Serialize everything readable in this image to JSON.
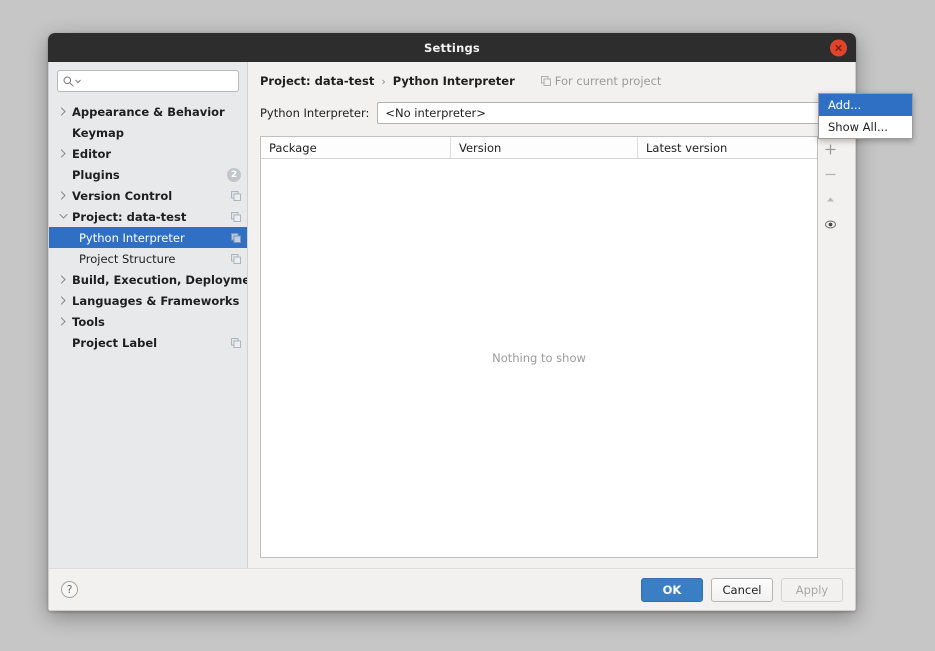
{
  "window": {
    "title": "Settings",
    "close_icon": "close-icon"
  },
  "sidebar": {
    "search": {
      "value": "",
      "placeholder": "",
      "icon": "search-icon"
    },
    "items": [
      {
        "label": "Appearance & Behavior",
        "level": 0,
        "twisty": "chevron-right",
        "bold": true,
        "selected": false,
        "badge": null,
        "copy_icon": false
      },
      {
        "label": "Keymap",
        "level": 0,
        "twisty": "none",
        "bold": true,
        "selected": false,
        "badge": null,
        "copy_icon": false
      },
      {
        "label": "Editor",
        "level": 0,
        "twisty": "chevron-right",
        "bold": true,
        "selected": false,
        "badge": null,
        "copy_icon": false
      },
      {
        "label": "Plugins",
        "level": 0,
        "twisty": "none",
        "bold": true,
        "selected": false,
        "badge": "2",
        "copy_icon": false
      },
      {
        "label": "Version Control",
        "level": 0,
        "twisty": "chevron-right",
        "bold": true,
        "selected": false,
        "badge": null,
        "copy_icon": true
      },
      {
        "label": "Project: data-test",
        "level": 0,
        "twisty": "chevron-down",
        "bold": true,
        "selected": false,
        "badge": null,
        "copy_icon": true
      },
      {
        "label": "Python Interpreter",
        "level": 1,
        "twisty": "none",
        "bold": false,
        "selected": true,
        "badge": null,
        "copy_icon": true
      },
      {
        "label": "Project Structure",
        "level": 1,
        "twisty": "none",
        "bold": false,
        "selected": false,
        "badge": null,
        "copy_icon": true
      },
      {
        "label": "Build, Execution, Deployment",
        "level": 0,
        "twisty": "chevron-right",
        "bold": true,
        "selected": false,
        "badge": null,
        "copy_icon": false
      },
      {
        "label": "Languages & Frameworks",
        "level": 0,
        "twisty": "chevron-right",
        "bold": true,
        "selected": false,
        "badge": null,
        "copy_icon": false
      },
      {
        "label": "Tools",
        "level": 0,
        "twisty": "chevron-right",
        "bold": true,
        "selected": false,
        "badge": null,
        "copy_icon": false
      },
      {
        "label": "Project Label",
        "level": 0,
        "twisty": "none",
        "bold": true,
        "selected": false,
        "badge": null,
        "copy_icon": true
      }
    ]
  },
  "main": {
    "breadcrumb": {
      "project": "Project: data-test",
      "separator": "›",
      "page": "Python Interpreter"
    },
    "scope_note": {
      "label": "For current project",
      "icon": "copy-icon"
    },
    "interpreter": {
      "label": "Python Interpreter:",
      "value": "<No interpreter>",
      "arrow_icon": "chevron-down-icon"
    },
    "table": {
      "columns": [
        "Package",
        "Version",
        "Latest version"
      ],
      "rows": [],
      "empty_text": "Nothing to show"
    },
    "table_tools": [
      {
        "name": "add-package-button",
        "icon": "plus-icon"
      },
      {
        "name": "remove-package-button",
        "icon": "minus-icon"
      },
      {
        "name": "upgrade-package-button",
        "icon": "triangle-up-icon"
      },
      {
        "name": "show-early-releases-button",
        "icon": "eye-icon"
      }
    ]
  },
  "popup_menu": {
    "items": [
      {
        "label": "Add...",
        "highlighted": true
      },
      {
        "label": "Show All...",
        "highlighted": false
      }
    ]
  },
  "footer": {
    "help_label": "?",
    "ok_label": "OK",
    "cancel_label": "Cancel",
    "apply_label": "Apply"
  },
  "colors": {
    "accent": "#2f70c4",
    "primary_button": "#3a7ec4",
    "titlebar": "#2d2d2d",
    "close_button": "#e0452b",
    "desktop": "#c6c6c6"
  }
}
